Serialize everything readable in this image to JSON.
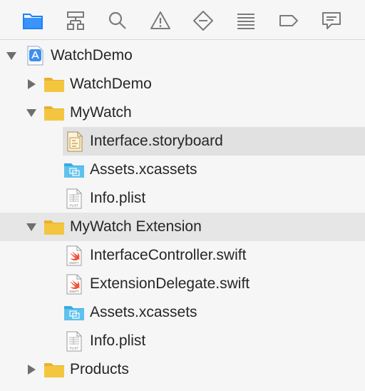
{
  "toolbar": {
    "icons": [
      "folder-icon",
      "hierarchy-icon",
      "search-icon",
      "warning-icon",
      "test-diamond-icon",
      "list-icon",
      "tag-icon",
      "comment-icon"
    ],
    "accent": "#1a82fb"
  },
  "tree": {
    "project": {
      "label": "WatchDemo"
    },
    "watchdemo_folder": {
      "label": "WatchDemo"
    },
    "mywatch_folder": {
      "label": "MyWatch"
    },
    "mywatch_storyboard": {
      "label": "Interface.storyboard"
    },
    "mywatch_assets": {
      "label": "Assets.xcassets"
    },
    "mywatch_plist": {
      "label": "Info.plist",
      "badge": "PLIST"
    },
    "extension_folder": {
      "label": "MyWatch Extension"
    },
    "ext_controller": {
      "label": "InterfaceController.swift",
      "badge": "SWIFT"
    },
    "ext_delegate": {
      "label": "ExtensionDelegate.swift",
      "badge": "SWIFT"
    },
    "ext_assets": {
      "label": "Assets.xcassets"
    },
    "ext_plist": {
      "label": "Info.plist",
      "badge": "PLIST"
    },
    "products_folder": {
      "label": "Products"
    }
  },
  "colors": {
    "folder": "#f4c63f",
    "assets": "#5ec2ef",
    "swift": "#f05138",
    "selection": "#e6e6e6"
  }
}
